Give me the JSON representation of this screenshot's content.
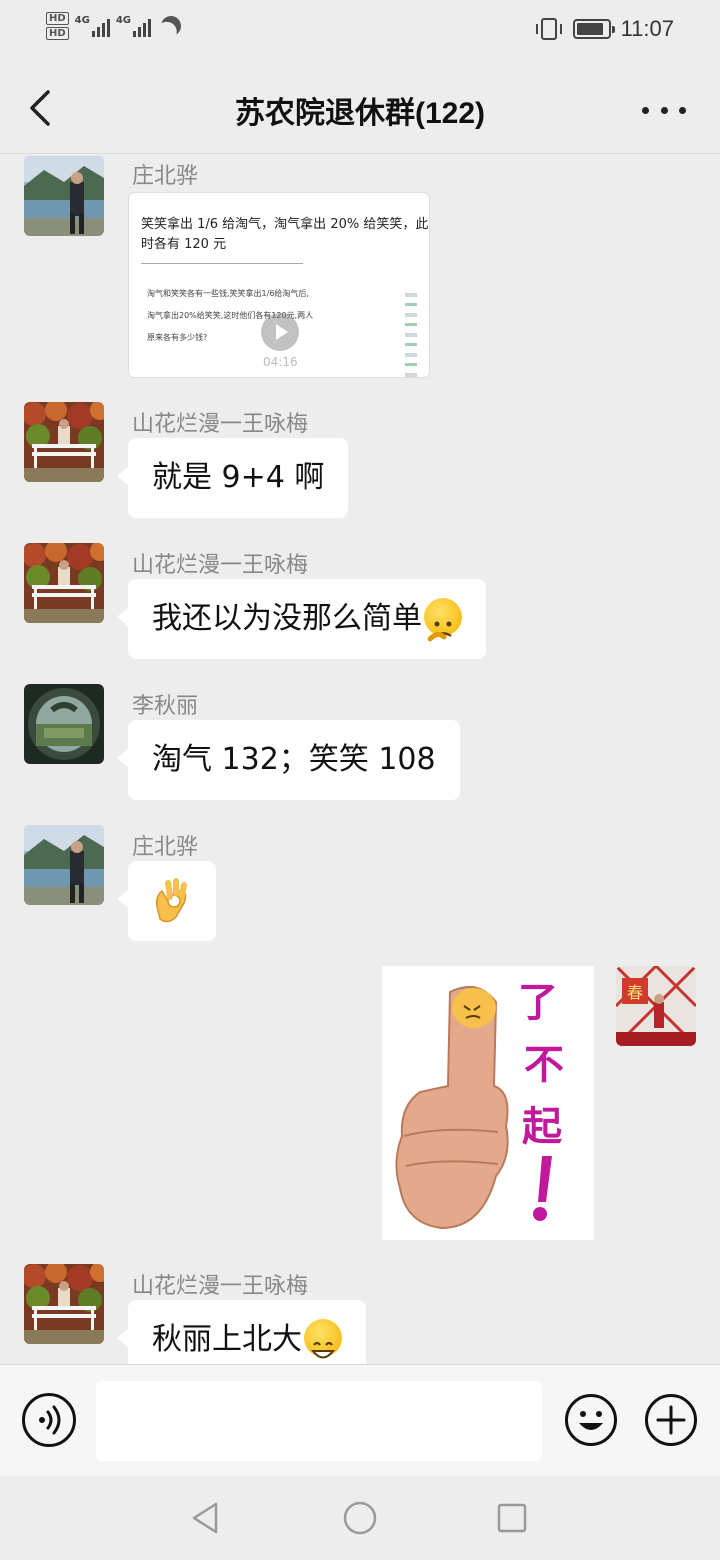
{
  "status_bar": {
    "sim1": "HD",
    "sim2": "HD",
    "net1": "4G",
    "net2": "4G",
    "time": "11:07"
  },
  "header": {
    "title": "苏农院退休群(122)"
  },
  "messages": [
    {
      "sender": "庄北骅",
      "type": "video",
      "question_title": "笑笑拿出 1/6 给淘气，淘气拿出 20% 给笑笑，此时各有 120 元",
      "question_body_1": "淘气和笑笑各有一些钱,笑笑拿出1/6给淘气后,",
      "question_body_2": "淘气拿出20%给笑笑,这时他们各有120元,两人",
      "question_body_3": "原来各有多少钱?",
      "duration": "04:16"
    },
    {
      "sender": "山花烂漫一王咏梅",
      "type": "text",
      "text": "就是 9+4 啊"
    },
    {
      "sender": "山花烂漫一王咏梅",
      "type": "text",
      "text": "我还以为没那么简单",
      "emoji": "thinking-face-emoji"
    },
    {
      "sender": "李秋丽",
      "type": "text",
      "text": "淘气 132；笑笑 108"
    },
    {
      "sender": "庄北骅",
      "type": "emoji",
      "emoji": "ok-hand-emoji"
    },
    {
      "sender": "me",
      "type": "sticker",
      "sticker_text": "了不起！"
    },
    {
      "sender": "山花烂漫一王咏梅",
      "type": "text",
      "text": "秋丽上北大",
      "emoji": "grinning-face-emoji"
    }
  ],
  "input": {
    "placeholder": ""
  },
  "icons": {
    "back": "chevron-left-icon",
    "more": "more-dots-icon",
    "voice": "voice-icon",
    "emoji": "smiley-icon",
    "plus": "plus-icon"
  },
  "colors": {
    "background": "#ededed",
    "bubble_in": "#ffffff",
    "text": "#111111",
    "sender_name": "#888888",
    "sticker_text": "#c2189c"
  }
}
